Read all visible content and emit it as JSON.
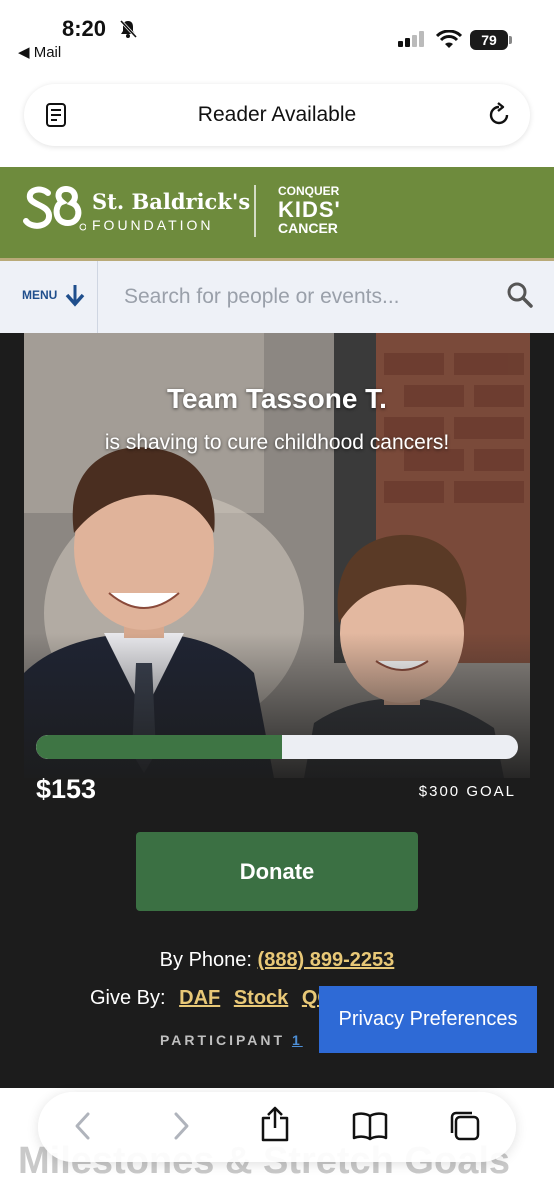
{
  "status_bar": {
    "time": "8:20",
    "back_app": "◀ Mail",
    "battery": "79"
  },
  "address_bar": {
    "text": "Reader Available"
  },
  "header": {
    "org_name": "St. Baldrick's",
    "org_sub": "FOUNDATION",
    "tagline_top": "CONQUER",
    "tagline_mid": "KIDS'",
    "tagline_bottom": "CANCER",
    "brand_color": "#6e8b3d"
  },
  "search": {
    "menu_label": "MENU",
    "placeholder": "Search for people or events..."
  },
  "hero": {
    "title": "Team Tassone T.",
    "subtitle": "is shaving to cure childhood cancers!",
    "raised": "$153",
    "goal": "$300 GOAL",
    "progress_fraction": 0.51
  },
  "donate_label": "Donate",
  "contact": {
    "phone_prefix": "By Phone:",
    "phone_number": "(888) 899-2253",
    "give_prefix": "Give By:",
    "give_daf": "DAF",
    "give_stock": "Stock",
    "give_qcd": "QCD",
    "participant_label": "PARTICIPANT",
    "participant_number": "1"
  },
  "privacy_label": "Privacy Preferences",
  "next_section": "Milestones & Stretch Goals",
  "toolbar": [
    "back-icon",
    "forward-icon",
    "share-icon",
    "bookmarks-icon",
    "tabs-icon"
  ]
}
